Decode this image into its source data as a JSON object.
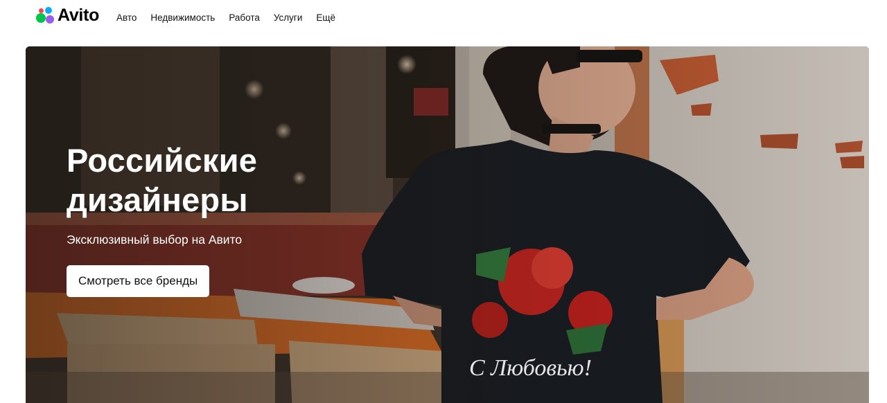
{
  "brand": {
    "name": "Avito"
  },
  "nav": {
    "items": [
      {
        "label": "Авто"
      },
      {
        "label": "Недвижимость"
      },
      {
        "label": "Работа"
      },
      {
        "label": "Услуги"
      },
      {
        "label": "Ещё"
      }
    ]
  },
  "hero": {
    "title_line1": "Российские",
    "title_line2": "дизайнеры",
    "subtitle": "Эксклюзивный выбор на Авито",
    "button_label": "Смотреть все бренды",
    "shirt_print_text": "С Любовью!"
  },
  "colors": {
    "logo_green": "#00c64e",
    "logo_blue": "#0aaaff",
    "logo_purple": "#965eeb",
    "logo_red": "#ff4053"
  }
}
